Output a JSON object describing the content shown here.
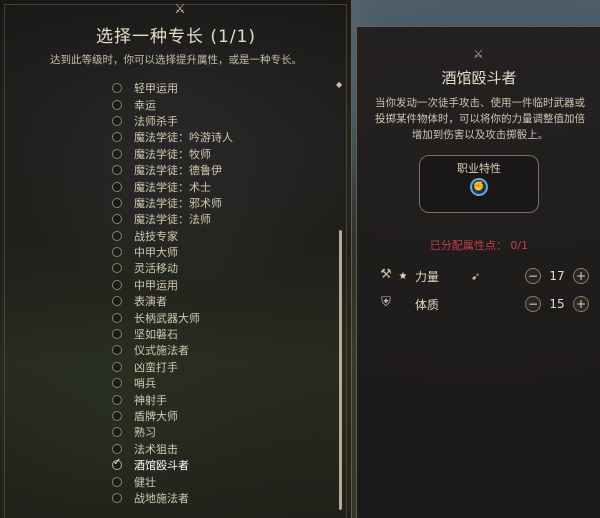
{
  "left_panel": {
    "title": "选择一种专长 (1/1)",
    "subtitle": "达到此等级时，你可以选择提升属性，或是一种专长。",
    "feats": [
      {
        "label": "轻甲运用",
        "selected": false
      },
      {
        "label": "幸运",
        "selected": false
      },
      {
        "label": "法师杀手",
        "selected": false
      },
      {
        "label": "魔法学徒：吟游诗人",
        "selected": false
      },
      {
        "label": "魔法学徒：牧师",
        "selected": false
      },
      {
        "label": "魔法学徒：德鲁伊",
        "selected": false
      },
      {
        "label": "魔法学徒：术士",
        "selected": false
      },
      {
        "label": "魔法学徒：邪术师",
        "selected": false
      },
      {
        "label": "魔法学徒：法师",
        "selected": false
      },
      {
        "label": "战技专家",
        "selected": false
      },
      {
        "label": "中甲大师",
        "selected": false
      },
      {
        "label": "灵活移动",
        "selected": false
      },
      {
        "label": "中甲运用",
        "selected": false
      },
      {
        "label": "表演者",
        "selected": false
      },
      {
        "label": "长柄武器大师",
        "selected": false
      },
      {
        "label": "坚如磐石",
        "selected": false
      },
      {
        "label": "仪式施法者",
        "selected": false
      },
      {
        "label": "凶蛮打手",
        "selected": false
      },
      {
        "label": "哨兵",
        "selected": false
      },
      {
        "label": "神射手",
        "selected": false
      },
      {
        "label": "盾牌大师",
        "selected": false
      },
      {
        "label": "熟习",
        "selected": false
      },
      {
        "label": "法术狙击",
        "selected": false
      },
      {
        "label": "酒馆殴斗者",
        "selected": true
      },
      {
        "label": "健壮",
        "selected": false
      },
      {
        "label": "战地施法者",
        "selected": false
      }
    ]
  },
  "right_panel": {
    "title": "酒馆殴斗者",
    "description": "当你发动一次徒手攻击、使用一件临时武器或投掷某件物体时，可以将你的力量调整值加倍增加到伤害以及攻击掷骰上。",
    "trait_label": "职业特性",
    "points_label": "已分配属性点：",
    "points_value": "0/1",
    "stats": [
      {
        "name": "力量",
        "value": "17",
        "icon": "strength-icon",
        "starred": true
      },
      {
        "name": "体质",
        "value": "15",
        "icon": "constitution-icon",
        "starred": false
      }
    ],
    "minus_glyph": "−",
    "plus_glyph": "+",
    "star_glyph": "★"
  },
  "colors": {
    "accent_red": "#c23f4d",
    "text_main": "#e6dcc6",
    "trait_blue": "#6aa6d8"
  }
}
